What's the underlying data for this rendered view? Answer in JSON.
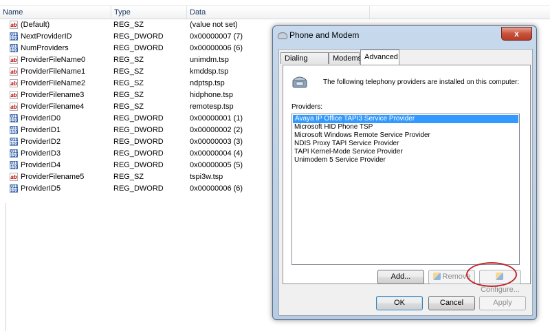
{
  "registry": {
    "columns": {
      "name": "Name",
      "type": "Type",
      "data": "Data"
    },
    "rows": [
      {
        "icon": "string-value-icon",
        "name": "(Default)",
        "type": "REG_SZ",
        "data": "(value not set)"
      },
      {
        "icon": "binary-value-icon",
        "name": "NextProviderID",
        "type": "REG_DWORD",
        "data": "0x00000007 (7)"
      },
      {
        "icon": "binary-value-icon",
        "name": "NumProviders",
        "type": "REG_DWORD",
        "data": "0x00000006 (6)"
      },
      {
        "icon": "string-value-icon",
        "name": "ProviderFileName0",
        "type": "REG_SZ",
        "data": "unimdm.tsp"
      },
      {
        "icon": "string-value-icon",
        "name": "ProviderFileName1",
        "type": "REG_SZ",
        "data": "kmddsp.tsp"
      },
      {
        "icon": "string-value-icon",
        "name": "ProviderFileName2",
        "type": "REG_SZ",
        "data": "ndptsp.tsp"
      },
      {
        "icon": "string-value-icon",
        "name": "ProviderFilename3",
        "type": "REG_SZ",
        "data": "hidphone.tsp"
      },
      {
        "icon": "string-value-icon",
        "name": "ProviderFilename4",
        "type": "REG_SZ",
        "data": "remotesp.tsp"
      },
      {
        "icon": "binary-value-icon",
        "name": "ProviderID0",
        "type": "REG_DWORD",
        "data": "0x00000001 (1)"
      },
      {
        "icon": "binary-value-icon",
        "name": "ProviderID1",
        "type": "REG_DWORD",
        "data": "0x00000002 (2)"
      },
      {
        "icon": "binary-value-icon",
        "name": "ProviderID2",
        "type": "REG_DWORD",
        "data": "0x00000003 (3)"
      },
      {
        "icon": "binary-value-icon",
        "name": "ProviderID3",
        "type": "REG_DWORD",
        "data": "0x00000004 (4)"
      },
      {
        "icon": "binary-value-icon",
        "name": "ProviderID4",
        "type": "REG_DWORD",
        "data": "0x00000005 (5)"
      },
      {
        "icon": "string-value-icon",
        "name": "ProviderFilename5",
        "type": "REG_SZ",
        "data": "tspi3w.tsp"
      },
      {
        "icon": "binary-value-icon",
        "name": "ProviderID5",
        "type": "REG_DWORD",
        "data": "0x00000006 (6)"
      }
    ]
  },
  "dialog": {
    "title": "Phone and Modem",
    "close_label": "x",
    "tabs": [
      {
        "label": "Dialing Rules",
        "active": false
      },
      {
        "label": "Modems",
        "active": false
      },
      {
        "label": "Advanced",
        "active": true
      }
    ],
    "intro_text": "The following telephony providers are installed on this computer:",
    "providers_label": "Providers:",
    "providers": [
      "Avaya IP Office TAPI3 Service Provider",
      "Microsoft HID Phone TSP",
      "Microsoft Windows Remote Service Provider",
      "NDIS Proxy TAPI Service Provider",
      "TAPI Kernel-Mode Service Provider",
      "Unimodem 5 Service Provider"
    ],
    "selected_index": 0,
    "buttons": {
      "add": "Add...",
      "remove": "Remove",
      "configure": "Configure...",
      "ok": "OK",
      "cancel": "Cancel",
      "apply": "Apply"
    },
    "colors": {
      "selection": "#3399ff",
      "highlight_ring": "#c0262c"
    }
  }
}
